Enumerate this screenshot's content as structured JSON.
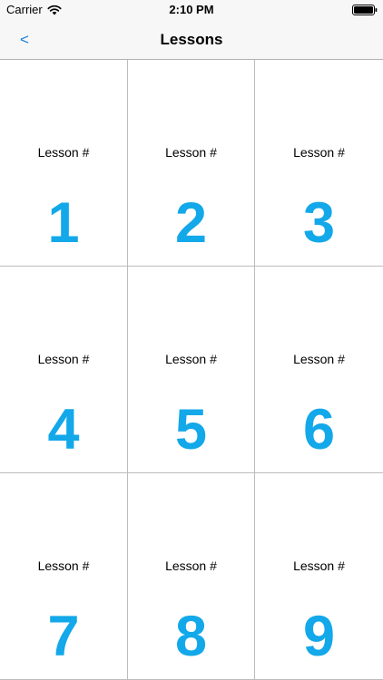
{
  "status_bar": {
    "carrier": "Carrier",
    "time": "2:10 PM",
    "wifi_icon": "wifi-icon",
    "battery_icon": "battery-icon"
  },
  "nav": {
    "back_label": "<",
    "title": "Lessons"
  },
  "colors": {
    "accent": "#1a7ed8",
    "lesson_number": "#13a8e9",
    "bar_background": "#f7f7f7",
    "grid_line": "#bcbcbc"
  },
  "lessons": [
    {
      "label": "Lesson #",
      "number": "1"
    },
    {
      "label": "Lesson #",
      "number": "2"
    },
    {
      "label": "Lesson #",
      "number": "3"
    },
    {
      "label": "Lesson #",
      "number": "4"
    },
    {
      "label": "Lesson #",
      "number": "5"
    },
    {
      "label": "Lesson #",
      "number": "6"
    },
    {
      "label": "Lesson #",
      "number": "7"
    },
    {
      "label": "Lesson #",
      "number": "8"
    },
    {
      "label": "Lesson #",
      "number": "9"
    }
  ]
}
